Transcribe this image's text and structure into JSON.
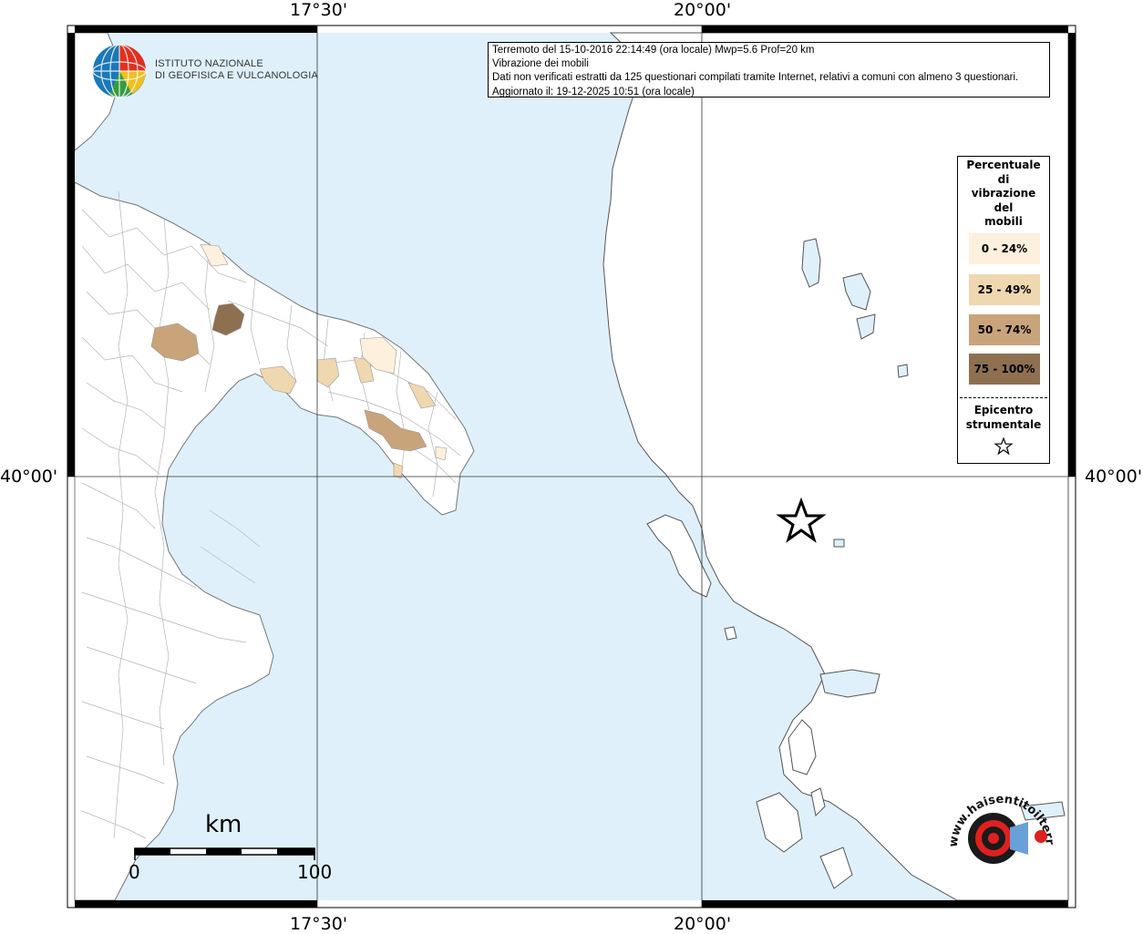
{
  "map": {
    "coord_labels": {
      "lon_17_30": "17°30'",
      "lon_20_00": "20°00'",
      "lat_40_00": "40°00'"
    },
    "colors": {
      "sea": "#dff0fb",
      "land": "#ffffff",
      "border": "#888888",
      "class_0_24": "#fdf0dc",
      "class_25_49": "#efd8b0",
      "class_50_74": "#c9a47b",
      "class_75_100": "#8e7051"
    }
  },
  "info": {
    "line1": "Terremoto del 15-10-2016 22:14:49 (ora locale) Mwp=5.6 Prof=20 km",
    "line2": "Vibrazione dei mobili",
    "line3": "Dati non verificati estratti da 125 questionari compilati tramite Internet, relativi a comuni con almeno 3 questionari.",
    "line4": "Aggiornato il: 19-12-2025 10:51 (ora locale)"
  },
  "legend": {
    "title_lines": [
      "Percentuale",
      "di",
      "vibrazione",
      "del",
      "mobili"
    ],
    "classes": [
      {
        "label": "0 - 24%",
        "color": "#fdf0dc"
      },
      {
        "label": "25 - 49%",
        "color": "#efd8b0"
      },
      {
        "label": "50 - 74%",
        "color": "#c9a47b"
      },
      {
        "label": "75 - 100%",
        "color": "#8e7051"
      }
    ],
    "epicenter_lines": [
      "Epicentro",
      "strumentale"
    ],
    "epicenter_icon": "star-icon"
  },
  "institute": {
    "name_line1": "ISTITUTO NAZIONALE",
    "name_line2": "DI GEOFISICA E VULCANOLOGIA",
    "logo_icon": "ingv-globe-icon"
  },
  "scale": {
    "unit": "km",
    "start": "0",
    "end": "100"
  },
  "logo": {
    "text_top": "www.haisentitoilterremoto.it",
    "icon": "haisentito-logo-icon"
  }
}
